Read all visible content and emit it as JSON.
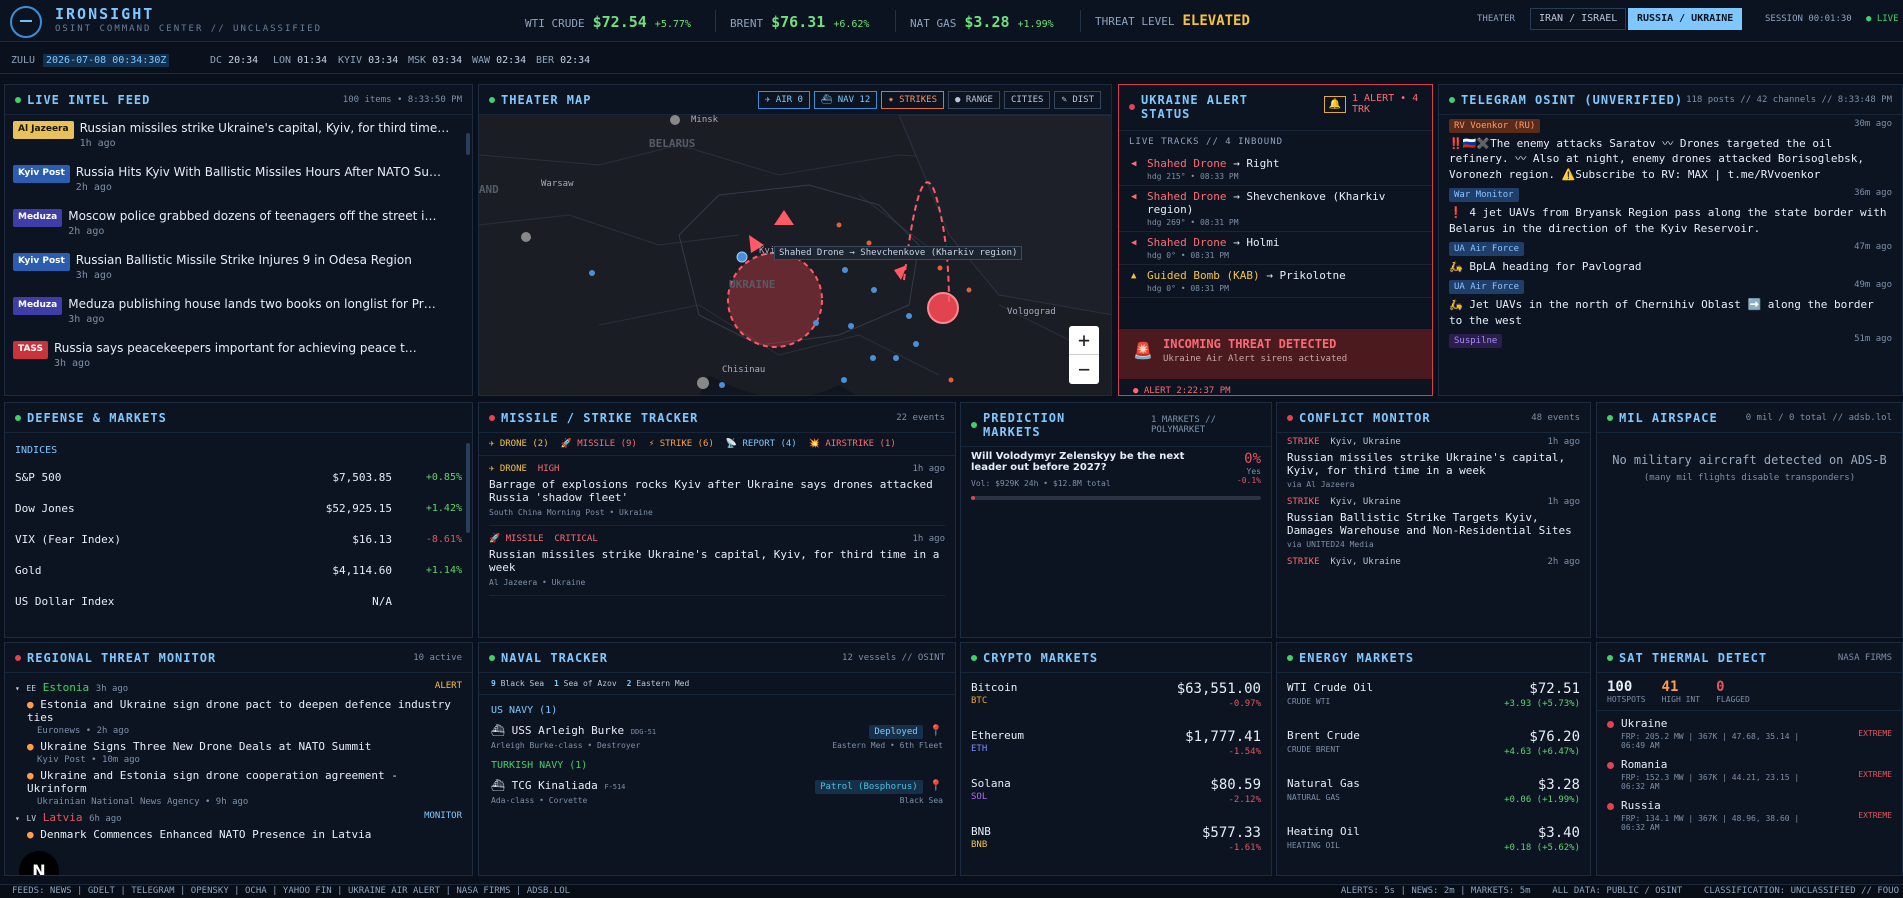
{
  "brand": {
    "name": "IRONSIGHT",
    "sub": "OSINT COMMAND CENTER // UNCLASSIFIED"
  },
  "tickers": [
    {
      "label": "WTI CRUDE",
      "value": "$72.54",
      "change": "+5.77%"
    },
    {
      "label": "BRENT",
      "value": "$76.31",
      "change": "+6.62%"
    },
    {
      "label": "NAT GAS",
      "value": "$3.28",
      "change": "+1.99%"
    }
  ],
  "threat": {
    "label": "THREAT LEVEL",
    "value": "ELEVATED"
  },
  "theater": {
    "label": "THEATER",
    "options": [
      "IRAN / ISRAEL",
      "RUSSIA / UKRAINE"
    ],
    "selected": "RUSSIA / UKRAINE"
  },
  "session": "SESSION 00:01:30",
  "live": "LIVE",
  "clocks": {
    "zulu_label": "ZULU",
    "zulu": "2026-07-08 00:34:30Z",
    "zones": [
      [
        "DC",
        "20:34"
      ],
      [
        "LON",
        "01:34"
      ],
      [
        "KYIV",
        "03:34"
      ],
      [
        "MSK",
        "03:34"
      ],
      [
        "WAW",
        "02:34"
      ],
      [
        "BER",
        "02:34"
      ]
    ]
  },
  "intel": {
    "title": "LIVE INTEL FEED",
    "meta": "100 items • 8:33:50 PM",
    "items": [
      {
        "src": "Al Jazeera",
        "title": "Russian missiles strike Ukraine's capital, Kyiv, for third time in a week",
        "time": "1h ago",
        "bg": "#e8c15a",
        "fg": "#1a1400"
      },
      {
        "src": "Kyiv Post",
        "title": "Russia Hits Kyiv With Ballistic Missiles Hours After NATO Summit",
        "time": "2h ago",
        "bg": "#2a5db0",
        "fg": "#fff"
      },
      {
        "src": "Meduza",
        "title": "Moscow police grabbed dozens of teenagers off the street in raids",
        "time": "2h ago",
        "bg": "#3f3da8",
        "fg": "#fff"
      },
      {
        "src": "Kyiv Post",
        "title": "Russian Ballistic Missile Strike Injures 9 in Odesa Region",
        "time": "3h ago",
        "bg": "#2a5db0",
        "fg": "#fff"
      },
      {
        "src": "Meduza",
        "title": "Meduza publishing house lands two books on longlist for Prize",
        "time": "3h ago",
        "bg": "#3f3da8",
        "fg": "#fff"
      },
      {
        "src": "TASS",
        "title": "Russia says peacekeepers important for achieving peace through talks",
        "time": "3h ago",
        "bg": "#c9333b",
        "fg": "#fff"
      }
    ]
  },
  "map": {
    "title": "THEATER MAP",
    "buttons": [
      "✈ AIR 0",
      "⛴ NAV 12",
      "✷ STRIKES",
      "● RANGE",
      "CITIES",
      "✎ DIST"
    ],
    "cities": [
      "Minsk",
      "BELARUS",
      "Warsaw",
      "POLAND",
      "Kyiv",
      "UKRAINE",
      "Chisinau",
      "Volgograd"
    ],
    "tooltip": "Shahed Drone → Shevchenkove (Kharkiv region)",
    "zoom_in": "+",
    "zoom_out": "−"
  },
  "alert": {
    "title": "UKRAINE ALERT STATUS",
    "badge": "1 ALERT • 4 TRK",
    "tracks_label": "LIVE TRACKS // 4 INBOUND",
    "tracks": [
      {
        "type": "Shahed Drone",
        "dest": "→ Right",
        "meta": "hdg 215° • 08:33 PM"
      },
      {
        "type": "Shahed Drone",
        "dest": "→ Shevchenkove (Kharkiv region)",
        "meta": "hdg 269° • 08:31 PM"
      },
      {
        "type": "Shahed Drone",
        "dest": "→ Holmi",
        "meta": "hdg 0° • 08:31 PM"
      },
      {
        "type": "Guided Bomb (KAB)",
        "dest": "→ Prikolotne",
        "meta": "hdg 0° • 08:31 PM"
      }
    ],
    "incoming": "INCOMING THREAT DETECTED",
    "incoming_sub": "Ukraine Air Alert sirens activated",
    "footer": "ALERT 2:22:37 PM"
  },
  "telegram": {
    "title": "TELEGRAM OSINT (UNVERIFIED)",
    "meta": "118 posts // 42 channels // 8:33:48 PM",
    "posts": [
      {
        "ch": "RV Voenkor (RU)",
        "time": "30m ago",
        "text": "‼️🇷🇺✖️The enemy attacks Saratov 〰 Drones targeted the oil refinery. 〰 Also at night, enemy drones attacked Borisoglebsk, Voronezh region. ⚠️Subscribe to RV: MAX | t.me/RVvoenkor",
        "bg": "#5a2a1a",
        "fg": "#ff9d6a"
      },
      {
        "ch": "War Monitor",
        "time": "36m ago",
        "text": "❗ 4 jet UAVs from Bryansk Region pass along the state border with Belarus in the direction of the Kyiv Reservoir.",
        "bg": "#1f3e6a",
        "fg": "#8cc4ff"
      },
      {
        "ch": "UA Air Force",
        "time": "47m ago",
        "text": "🛵 BpLA heading for Pavlograd",
        "bg": "#1f3e6a",
        "fg": "#8cc4ff"
      },
      {
        "ch": "UA Air Force",
        "time": "49m ago",
        "text": "🛵 Jet UAVs in the north of Chernihiv Oblast ➡️ along the border to the west",
        "bg": "#1f3e6a",
        "fg": "#8cc4ff"
      },
      {
        "ch": "Suspilne",
        "time": "51m ago",
        "text": "",
        "bg": "#2a1f4a",
        "fg": "#a98bff"
      }
    ]
  },
  "defense": {
    "title": "DEFENSE & MARKETS",
    "section": "INDICES",
    "rows": [
      [
        "S&P 500",
        "$7,503.85",
        "+0.85%"
      ],
      [
        "Dow Jones",
        "$52,925.15",
        "+1.42%"
      ],
      [
        "VIX (Fear Index)",
        "$16.13",
        "-8.61%"
      ],
      [
        "Gold",
        "$4,114.60",
        "+1.14%"
      ],
      [
        "US Dollar Index",
        "N/A",
        ""
      ]
    ]
  },
  "missile": {
    "title": "MISSILE / STRIKE TRACKER",
    "meta": "22 events",
    "filters": [
      "DRONE (2)",
      "MISSILE (9)",
      "STRIKE (6)",
      "REPORT (4)",
      "AIRSTRIKE (1)"
    ],
    "events": [
      {
        "type": "DRONE",
        "sev": "HIGH",
        "time": "1h ago",
        "title": "Barrage of explosions rocks Kyiv after Ukraine says drones attacked Russia 'shadow fleet'",
        "src": "South China Morning Post • Ukraine"
      },
      {
        "type": "MISSILE",
        "sev": "CRITICAL",
        "time": "1h ago",
        "title": "Russian missiles strike Ukraine's capital, Kyiv, for third time in a week",
        "src": "Al Jazeera • Ukraine"
      }
    ]
  },
  "prediction": {
    "title": "PREDICTION MARKETS",
    "meta": "1 MARKETS // POLYMARKET",
    "q": "Will Volodymyr Zelenskyy be the next leader out before 2027?",
    "pct": "0%",
    "yes": "Yes",
    "chg": "-0.1%",
    "vol": "Vol: $929K 24h • $12.8M total",
    "prob": 0.005
  },
  "conflict": {
    "title": "CONFLICT MONITOR",
    "meta": "48 events",
    "items": [
      {
        "type": "STRIKE",
        "loc": "Kyiv, Ukraine",
        "time": "1h ago",
        "title": "Russian missiles strike Ukraine's capital, Kyiv, for third time in a week",
        "via": "via Al Jazeera"
      },
      {
        "type": "STRIKE",
        "loc": "Kyiv, Ukraine",
        "time": "1h ago",
        "title": "Russian Ballistic Strike Targets Kyiv, Damages Warehouse and Non-Residential Sites",
        "via": "via UNITED24 Media"
      },
      {
        "type": "STRIKE",
        "loc": "Kyiv, Ukraine",
        "time": "2h ago",
        "title": "",
        "via": ""
      }
    ]
  },
  "air": {
    "title": "MIL AIRSPACE",
    "meta": "0 mil / 0 total // adsb.lol",
    "msg": "No military aircraft detected on ADS-B",
    "sub": "(many mil flights disable transponders)"
  },
  "regional": {
    "title": "REGIONAL THREAT MONITOR",
    "meta": "10 active",
    "groups": [
      {
        "code": "EE",
        "name": "Estonia",
        "time": "3h ago",
        "level": "ALERT",
        "items": [
          [
            "Estonia and Ukraine sign drone pact to deepen defence industry ties",
            "Euronews • 2h ago"
          ],
          [
            "Ukraine Signs Three New Drone Deals at NATO Summit",
            "Kyiv Post • 10m ago"
          ],
          [
            "Ukraine and Estonia sign drone cooperation agreement - Ukrinform",
            "Ukrainian National News Agency • 9h ago"
          ]
        ]
      },
      {
        "code": "LV",
        "name": "Latvia",
        "time": "6h ago",
        "level": "MONITOR",
        "items": [
          [
            "Denmark Commences Enhanced NATO Presence in Latvia",
            ""
          ]
        ]
      }
    ]
  },
  "naval": {
    "title": "NAVAL TRACKER",
    "meta": "12 vessels // OSINT",
    "regions": [
      [
        "9",
        "Black Sea"
      ],
      [
        "1",
        "Sea of Azov"
      ],
      [
        "2",
        "Eastern Med"
      ]
    ],
    "navies": [
      {
        "name": "US NAVY (1)",
        "ship": "USS Arleigh Burke",
        "hull": "DDG-51",
        "cls": "Arleigh Burke-class • Destroyer",
        "status": "Deployed",
        "loc": "Eastern Med • 6th Fleet"
      },
      {
        "name": "TURKISH NAVY (1)",
        "ship": "TCG Kinaliada",
        "hull": "F-514",
        "cls": "Ada-class • Corvette",
        "status": "Patrol (Bosphorus)",
        "loc": "Black Sea"
      }
    ]
  },
  "crypto": {
    "title": "CRYPTO MARKETS",
    "rows": [
      [
        "Bitcoin",
        "BTC",
        "$63,551.00",
        "-0.97%"
      ],
      [
        "Ethereum",
        "ETH",
        "$1,777.41",
        "-1.54%"
      ],
      [
        "Solana",
        "SOL",
        "$80.59",
        "-2.12%"
      ],
      [
        "BNB",
        "BNB",
        "$577.33",
        "-1.61%"
      ]
    ]
  },
  "energy": {
    "title": "ENERGY MARKETS",
    "rows": [
      [
        "WTI Crude Oil",
        "CRUDE WTI",
        "$72.51",
        "+3.93 (+5.73%)"
      ],
      [
        "Brent Crude",
        "CRUDE BRENT",
        "$76.20",
        "+4.63 (+6.47%)"
      ],
      [
        "Natural Gas",
        "NATURAL GAS",
        "$3.28",
        "+0.06 (+1.99%)"
      ],
      [
        "Heating Oil",
        "HEATING OIL",
        "$3.40",
        "+0.18 (+5.62%)"
      ]
    ]
  },
  "thermal": {
    "title": "SAT THERMAL DETECT",
    "meta": "NASA FIRMS",
    "stats": [
      [
        "100",
        "HOTSPOTS"
      ],
      [
        "41",
        "HIGH INT"
      ],
      [
        "0",
        "FLAGGED"
      ]
    ],
    "rows": [
      [
        "Ukraine",
        "FRP: 205.2 MW | 367K | 47.68, 35.14 | 06:49 AM",
        "EXTREME"
      ],
      [
        "Romania",
        "FRP: 152.3 MW | 367K | 44.21, 23.15 | 06:32 AM",
        "EXTREME"
      ],
      [
        "Russia",
        "FRP: 134.1 MW | 367K | 48.96, 38.60 | 06:32 AM",
        "EXTREME"
      ]
    ]
  },
  "footer": {
    "feeds": "FEEDS: NEWS | GDELT | TELEGRAM | OPENSKY | OCHA | YAHOO FIN | UKRAINE AIR ALERT | NASA FIRMS | ADSB.LOL",
    "right": "ALERTS: 5s | NEWS: 2m | MARKETS: 5m    ALL DATA: PUBLIC / OSINT    CLASSIFICATION: UNCLASSIFIED // FOUO"
  },
  "fab": "N"
}
